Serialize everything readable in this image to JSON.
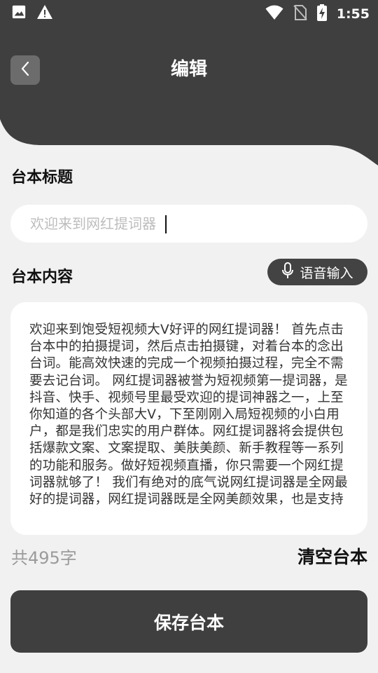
{
  "status_bar": {
    "time": "1:55",
    "left_icons": [
      "image-icon",
      "warning-icon"
    ],
    "right_icons": [
      "wifi-icon",
      "no-sim-icon",
      "battery-charging-icon"
    ]
  },
  "header": {
    "title": "编辑",
    "back_icon": "chevron-left-icon",
    "background_color": "#3f3f3f"
  },
  "form": {
    "title_label": "台本标题",
    "title_input": {
      "value": "",
      "placeholder": "欢迎来到网红提词器"
    },
    "content_label": "台本内容",
    "voice_input_label": "语音输入",
    "content_text": "欢迎来到饱受短视频大V好评的网红提词器！ 首先点击台本中的拍摄提词，然后点击拍摄键，对着台本的念出台词。能高效快速的完成一个视频拍摄过程，完全不需要去记台词。 网红提词器被誉为短视频第一提词器，是抖音、快手、视频号里最受欢迎的提词神器之一，上至你知道的各个头部大V，下至刚刚入局短视频的小白用户，都是我们忠实的用户群体。网红提词器将会提供包括爆款文案、文案提取、美肤美颜、新手教程等一系列的功能和服务。做好短视频直播，你只需要一个网红提词器就够了！ 我们有绝对的底气说网红提词器是全网最好的提词器，网红提词器既是全网美颜效果，也是支持",
    "char_count": "共495字",
    "clear_label": "清空台本",
    "save_label": "保存台本"
  },
  "colors": {
    "accent": "#3f3f3f",
    "page_background": "#f1f1f1",
    "card_background": "#ffffff",
    "muted_text": "#9b9b9b"
  }
}
